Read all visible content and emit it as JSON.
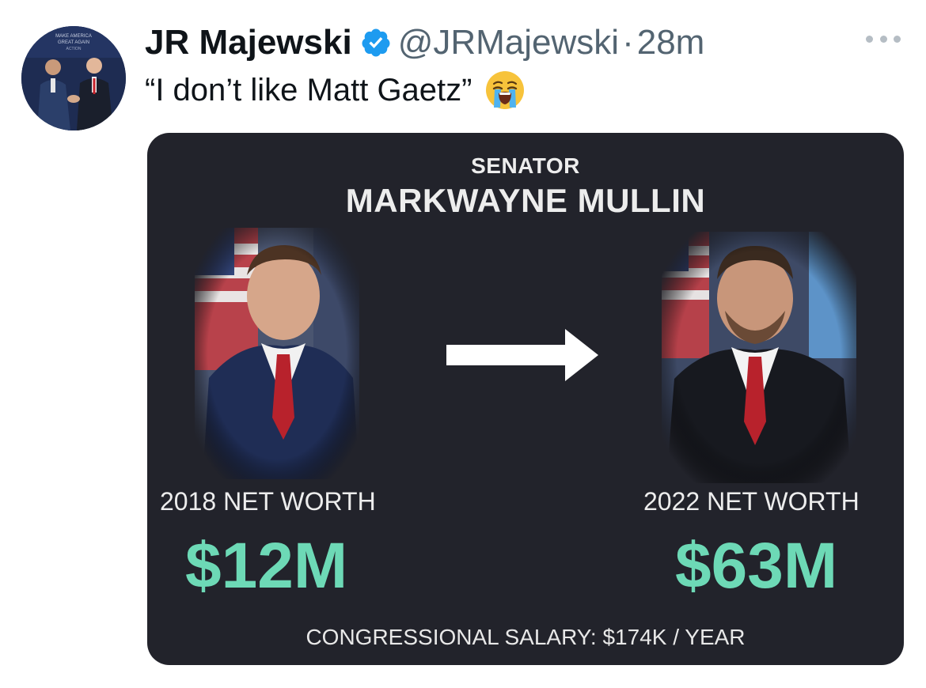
{
  "tweet": {
    "author_name": "JR Majewski",
    "handle": "@JRMajewski",
    "separator": "·",
    "time": "28m",
    "text": "“I don’t like Matt Gaetz”",
    "emoji": "loudly-crying-face",
    "avatar_banner": "MAKE AMERICA GREAT AGAIN ACTION",
    "verified_color": "#1d9bf0"
  },
  "media": {
    "title_small": "SENATOR",
    "title_large": "MARKWAYNE MULLIN",
    "left_label": "2018 NET WORTH",
    "left_value": "$12M",
    "right_label": "2022 NET WORTH",
    "right_value": "$63M",
    "salary": "CONGRESSIONAL SALARY: $174K / YEAR",
    "background_color": "#22232b",
    "value_color": "#6dd9b6"
  }
}
